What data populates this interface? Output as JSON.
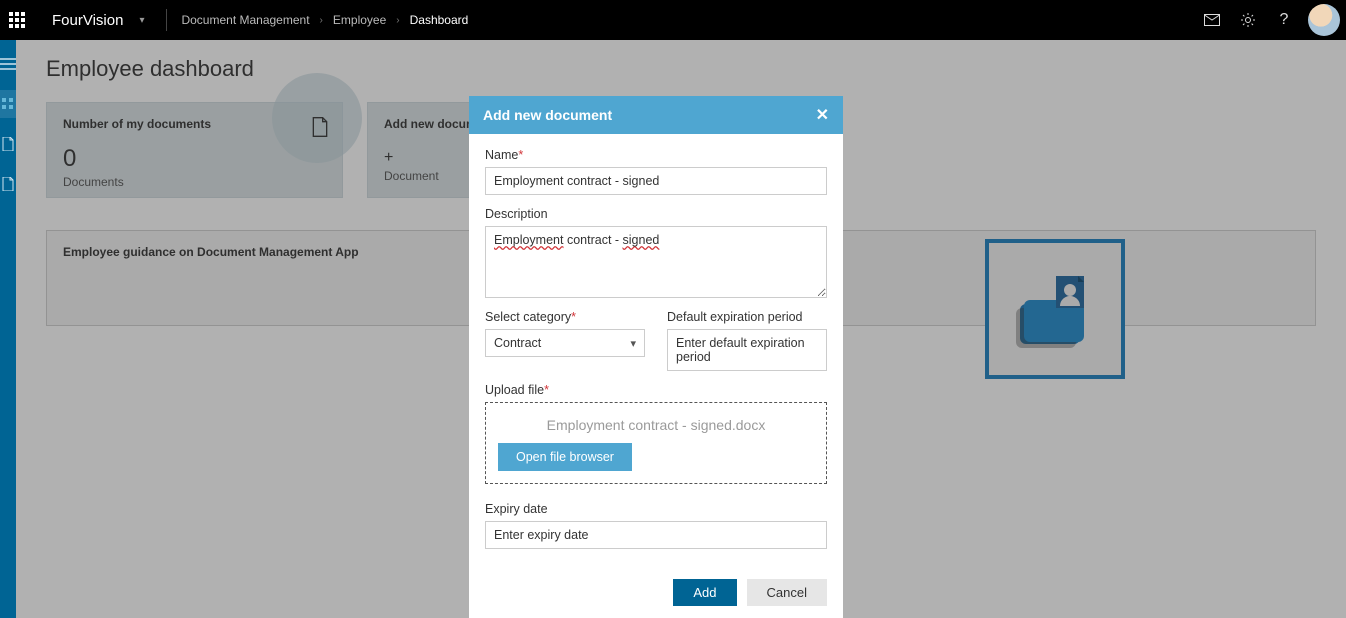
{
  "topbar": {
    "company": "FourVision",
    "breadcrumbs": [
      {
        "label": "Document Management"
      },
      {
        "label": "Employee"
      },
      {
        "label": "Dashboard",
        "active": true
      }
    ]
  },
  "page": {
    "title": "Employee dashboard"
  },
  "tiles": {
    "docs": {
      "title": "Number of my documents",
      "value": "0",
      "sub": "Documents"
    },
    "add": {
      "title": "Add new document",
      "plus": "+",
      "sub": "Document"
    }
  },
  "guidance": {
    "title": "Employee guidance on Document Management App"
  },
  "dialog": {
    "title": "Add new document",
    "labels": {
      "name": "Name",
      "description": "Description",
      "category": "Select category",
      "expiration": "Default expiration period",
      "upload": "Upload file",
      "expiry": "Expiry date"
    },
    "placeholders": {
      "expiration": "Enter default expiration period",
      "expiry": "Enter expiry date"
    },
    "values": {
      "name": "Employment contract - signed",
      "description_word1": "Employment",
      "description_mid": " contract - ",
      "description_word2": "signed",
      "category": "Contract",
      "file": "Employment contract - signed.docx"
    },
    "buttons": {
      "browse": "Open file browser",
      "add": "Add",
      "cancel": "Cancel"
    }
  }
}
